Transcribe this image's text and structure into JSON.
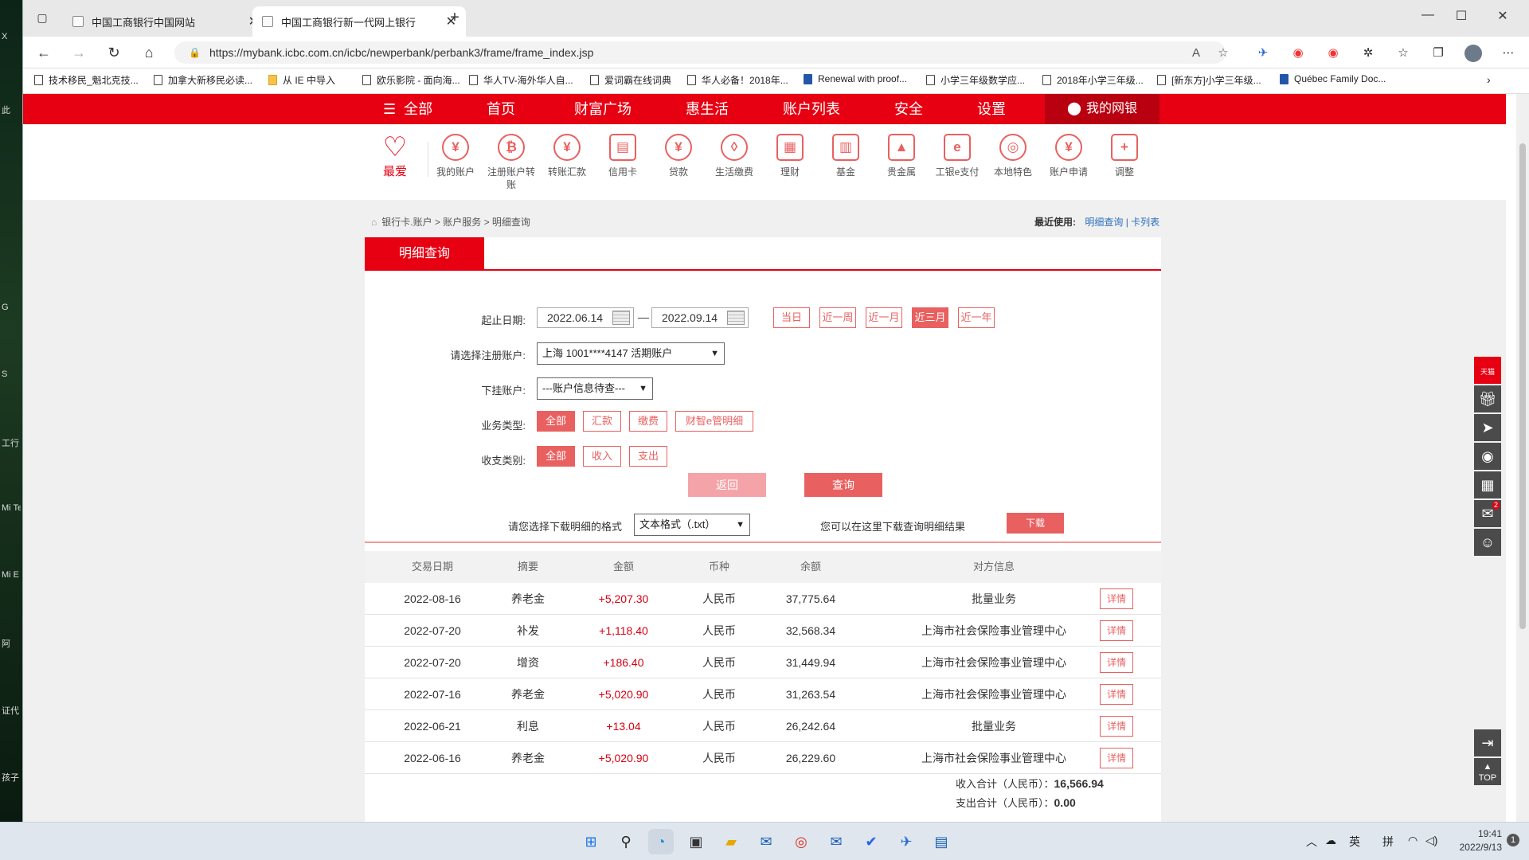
{
  "desktop": {
    "labels": [
      "X",
      "此",
      "G",
      "S",
      "工行",
      "Mi Tea",
      "Mi E",
      "阿",
      "证代",
      "孩子"
    ]
  },
  "browser": {
    "tabs": [
      {
        "title": "中国工商银行中国网站"
      },
      {
        "title": "中国工商银行新一代网上银行"
      }
    ],
    "url": "https://mybank.icbc.com.cn/icbc/newperbank/perbank3/frame/frame_index.jsp",
    "bookmarks": [
      "技术移民_魁北克技...",
      "加拿大新移民必读...",
      "从 IE 中导入",
      "欧乐影院 - 面向海...",
      "华人TV-海外华人自...",
      "爱词霸在线词典",
      "华人必备！2018年...",
      "Renewal with proof...",
      "小学三年级数学应...",
      "2018年小学三年级...",
      "[新东方]小学三年级...",
      "Québec Family Doc..."
    ]
  },
  "nav": {
    "all": "全部",
    "items": [
      "首页",
      "财富广场",
      "惠生活",
      "账户列表",
      "安全",
      "设置"
    ],
    "mybank": "我的网银"
  },
  "quick_icons": [
    {
      "label": "最爱",
      "icon": "heart-icon",
      "glyph": "♡"
    },
    {
      "label": "我的账户",
      "icon": "yuan-icon",
      "glyph": "¥"
    },
    {
      "label": "注册账户转账",
      "icon": "transfer-icon",
      "glyph": "₿"
    },
    {
      "label": "转账汇款",
      "icon": "remit-icon",
      "glyph": "¥"
    },
    {
      "label": "信用卡",
      "icon": "credit-card-icon",
      "glyph": "▤"
    },
    {
      "label": "贷款",
      "icon": "loan-bag-icon",
      "glyph": "¥"
    },
    {
      "label": "生活缴费",
      "icon": "drop-icon",
      "glyph": "◊"
    },
    {
      "label": "理财",
      "icon": "finance-icon",
      "glyph": "▦"
    },
    {
      "label": "基金",
      "icon": "fund-chart-icon",
      "glyph": "▥"
    },
    {
      "label": "贵金属",
      "icon": "gold-bars-icon",
      "glyph": "▲"
    },
    {
      "label": "工银e支付",
      "icon": "epay-icon",
      "glyph": "e"
    },
    {
      "label": "本地特色",
      "icon": "local-icon",
      "glyph": "◎"
    },
    {
      "label": "账户申请",
      "icon": "apply-icon",
      "glyph": "¥"
    },
    {
      "label": "调整",
      "icon": "plus-icon",
      "glyph": "+"
    }
  ],
  "breadcrumb": "银行卡.账户 > 账户服务 > 明细查询",
  "recent": {
    "label": "最近使用:",
    "links": [
      "明细查询",
      "卡列表"
    ],
    "sep": "|"
  },
  "panel_tab": "明细查询",
  "form": {
    "date_label": "起止日期:",
    "start_date": "2022.06.14",
    "end_date": "2022.09.14",
    "dash": "—",
    "quick_ranges": [
      "当日",
      "近一周",
      "近一月",
      "近三月",
      "近一年"
    ],
    "account_label": "请选择注册账户:",
    "account_value": "上海 1001****4147 活期账户",
    "sub_label": "下挂账户:",
    "sub_value": "---账户信息待查---",
    "biz_label": "业务类型:",
    "biz_types": [
      "全部",
      "汇款",
      "缴费",
      "财智e管明细"
    ],
    "io_label": "收支类别:",
    "io_types": [
      "全部",
      "收入",
      "支出"
    ],
    "back_btn": "返回",
    "query_btn": "查询"
  },
  "download": {
    "format_label": "请您选择下载明细的格式",
    "format_value": "文本格式（.txt）",
    "hint": "您可以在这里下载查询明细结果",
    "button": "下载"
  },
  "table": {
    "headers": [
      "交易日期",
      "摘要",
      "金额",
      "币种",
      "余额",
      "对方信息"
    ],
    "detail_label": "详情",
    "rows": [
      {
        "date": "2022-08-16",
        "summary": "养老金",
        "amount": "+5,207.30",
        "currency": "人民币",
        "balance": "37,775.64",
        "party": "批量业务"
      },
      {
        "date": "2022-07-20",
        "summary": "补发",
        "amount": "+1,118.40",
        "currency": "人民币",
        "balance": "32,568.34",
        "party": "上海市社会保险事业管理中心"
      },
      {
        "date": "2022-07-20",
        "summary": "增资",
        "amount": "+186.40",
        "currency": "人民币",
        "balance": "31,449.94",
        "party": "上海市社会保险事业管理中心"
      },
      {
        "date": "2022-07-16",
        "summary": "养老金",
        "amount": "+5,020.90",
        "currency": "人民币",
        "balance": "31,263.54",
        "party": "上海市社会保险事业管理中心"
      },
      {
        "date": "2022-06-21",
        "summary": "利息",
        "amount": "+13.04",
        "currency": "人民币",
        "balance": "26,242.64",
        "party": "批量业务"
      },
      {
        "date": "2022-06-16",
        "summary": "养老金",
        "amount": "+5,020.90",
        "currency": "人民币",
        "balance": "26,229.60",
        "party": "上海市社会保险事业管理中心"
      }
    ]
  },
  "summary": {
    "income_label": "收入合计（人民币）：",
    "income_value": "16,566.94",
    "expense_label": "支出合计（人民币）：",
    "expense_value": "0.00"
  },
  "sidetools": {
    "mail_badge": "2",
    "top_label": "TOP",
    "red_label": "天猫"
  },
  "taskbar": {
    "lang": "英",
    "ime": "拼",
    "time": "19:41",
    "date": "2022/9/13",
    "notif": "1"
  },
  "colors": {
    "brand_red": "#e60012",
    "accent_red": "#e96060",
    "amount_red": "#d40012"
  }
}
